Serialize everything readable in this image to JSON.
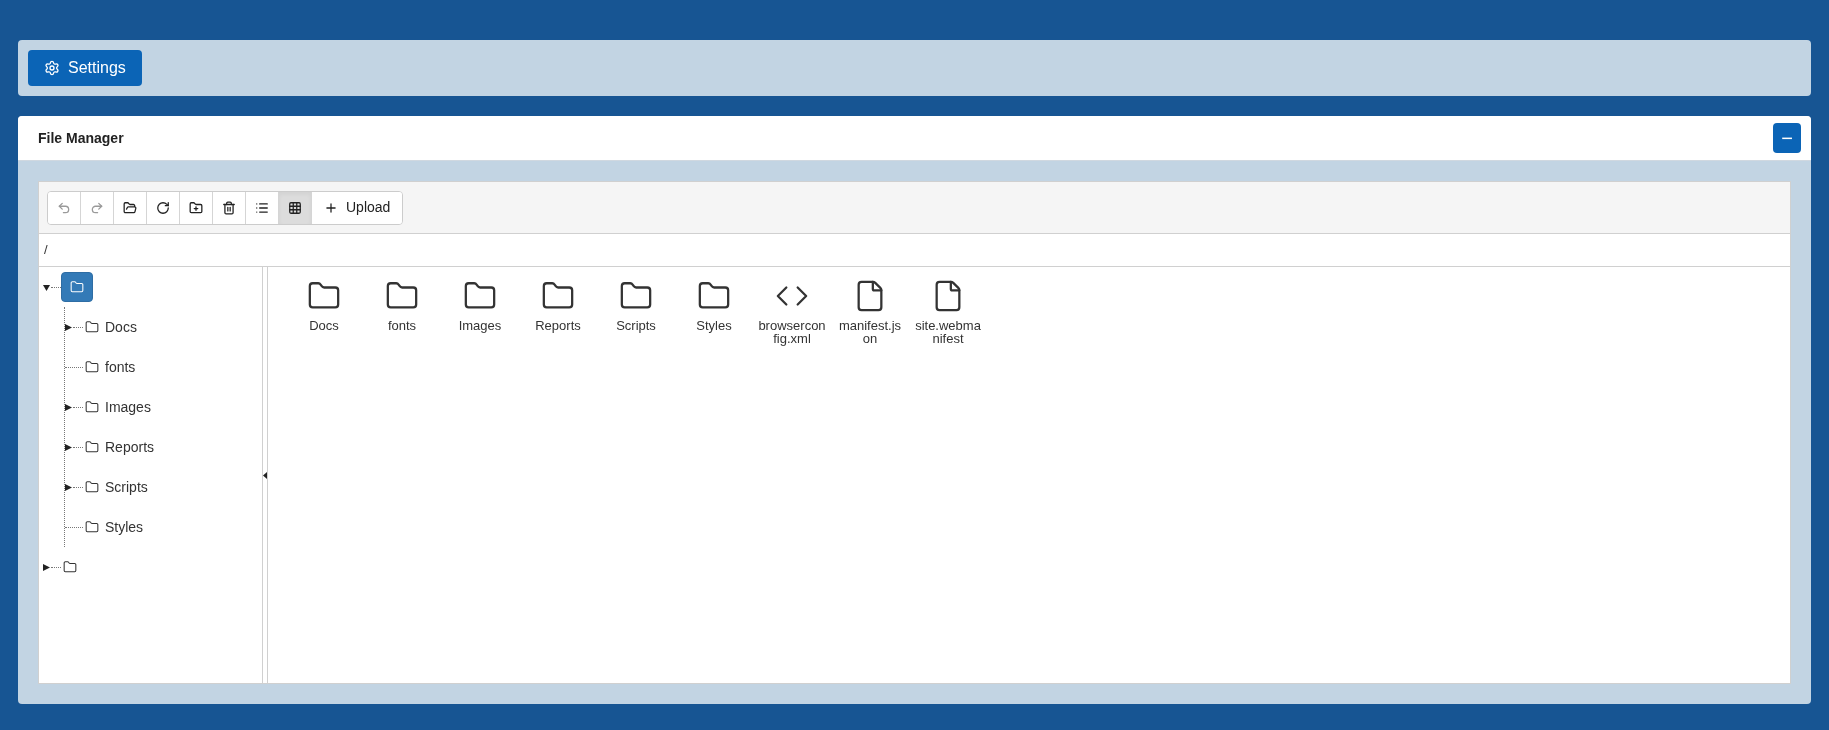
{
  "top_bar": {
    "settings_button": "Settings"
  },
  "panel": {
    "title": "File Manager",
    "collapse_button": "−"
  },
  "toolbar": [
    {
      "kind": "back",
      "disabled": true,
      "selected": false
    },
    {
      "kind": "forward",
      "disabled": true,
      "selected": false
    },
    {
      "kind": "open",
      "disabled": false,
      "selected": false
    },
    {
      "kind": "refresh",
      "disabled": false,
      "selected": false
    },
    {
      "kind": "new-folder",
      "disabled": false,
      "selected": false
    },
    {
      "kind": "delete",
      "disabled": false,
      "selected": false
    },
    {
      "kind": "list-view",
      "disabled": false,
      "selected": false
    },
    {
      "kind": "grid-view",
      "disabled": false,
      "selected": true
    },
    {
      "kind": "upload",
      "label": "Upload",
      "disabled": false,
      "selected": false
    }
  ],
  "path": "/",
  "tree": [
    {
      "selected": true,
      "expanded": true,
      "expandable": true,
      "children": [
        {
          "label": "Docs",
          "selected": false,
          "expandable": true
        },
        {
          "label": "fonts",
          "selected": false,
          "expandable": false
        },
        {
          "label": "Images",
          "selected": false,
          "expandable": true
        },
        {
          "label": "Reports",
          "selected": false,
          "expandable": true
        },
        {
          "label": "Scripts",
          "selected": false,
          "expandable": true
        },
        {
          "label": "Styles",
          "selected": false,
          "expandable": false
        }
      ]
    },
    {
      "selected": false,
      "expanded": false,
      "expandable": true
    }
  ],
  "files": [
    {
      "kind": "folder",
      "name": "Docs"
    },
    {
      "kind": "folder",
      "name": "fonts"
    },
    {
      "kind": "folder",
      "name": "Images"
    },
    {
      "kind": "folder",
      "name": "Reports"
    },
    {
      "kind": "folder",
      "name": "Scripts"
    },
    {
      "kind": "folder",
      "name": "Styles"
    },
    {
      "kind": "code",
      "name": "browserconfig.xml"
    },
    {
      "kind": "file",
      "name": "manifest.json"
    },
    {
      "kind": "file",
      "name": "site.webmanifest"
    }
  ]
}
